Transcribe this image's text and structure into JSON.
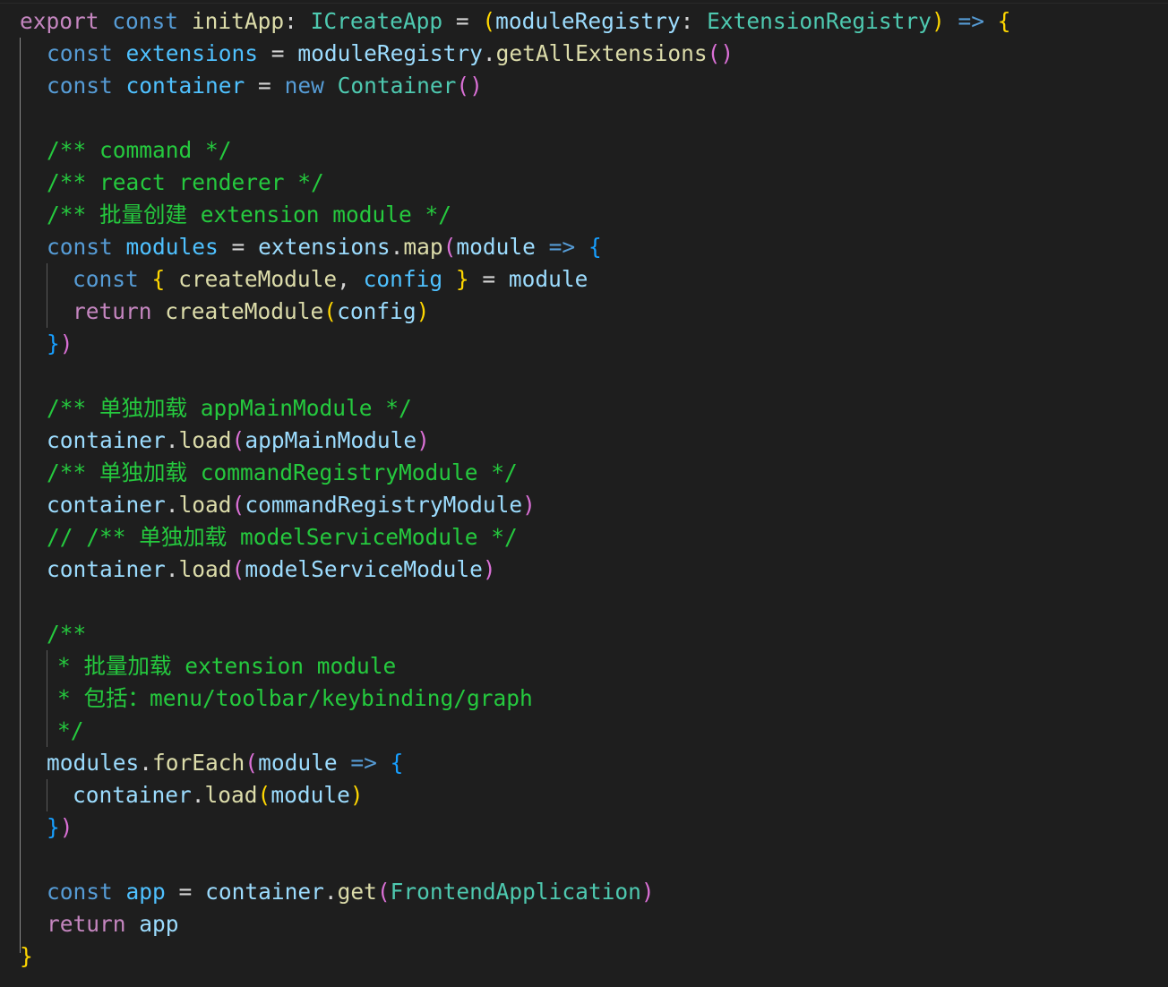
{
  "editor": {
    "language": "typescript",
    "theme": "dark",
    "colors": {
      "background": "#1e1e1e",
      "keyword": "#569cd6",
      "control_keyword": "#c586c0",
      "function": "#dcdcaa",
      "type": "#4ec9b0",
      "variable": "#9cdcfe",
      "comment": "#25c93e",
      "bracket_level_1": "#ffd700",
      "bracket_level_2": "#da70d6",
      "bracket_level_3": "#179fff"
    },
    "lines": [
      "export const initApp: ICreateApp = (moduleRegistry: ExtensionRegistry) => {",
      "  const extensions = moduleRegistry.getAllExtensions()",
      "  const container = new Container()",
      "",
      "  /** command */",
      "  /** react renderer */",
      "  /** 批量创建 extension module */",
      "  const modules = extensions.map(module => {",
      "    const { createModule, config } = module",
      "    return createModule(config)",
      "  })",
      "",
      "  /** 单独加载 appMainModule */",
      "  container.load(appMainModule)",
      "  /** 单独加载 commandRegistryModule */",
      "  container.load(commandRegistryModule)",
      "  // /** 单独加载 modelServiceModule */",
      "  container.load(modelServiceModule)",
      "",
      "  /**",
      "   * 批量加载 extension module",
      "   * 包括：menu/toolbar/keybinding/graph",
      "   */",
      "  modules.forEach(module => {",
      "    container.load(module)",
      "  })",
      "",
      "  const app = container.get(FrontendApplication)",
      "  return app",
      "}"
    ]
  }
}
